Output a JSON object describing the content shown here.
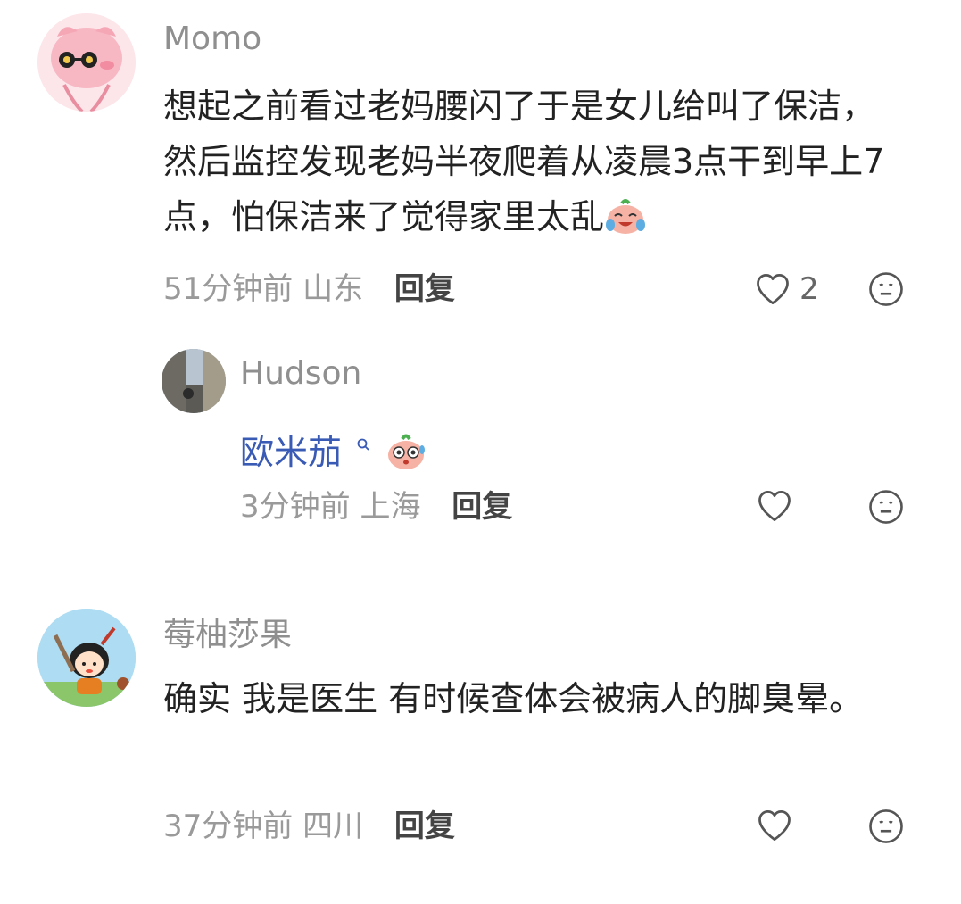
{
  "comments": [
    {
      "username": "Momo",
      "content": "想起之前看过老妈腰闪了于是女儿给叫了保洁，然后监控发现老妈半夜爬着从凌晨3点干到早上7点，怕保洁来了觉得家里太乱",
      "time": "51分钟前",
      "location": "山东",
      "reply_label": "回复",
      "like_count": "2",
      "emoji": "crying-laughing-peach-emoji"
    },
    {
      "username": "Hudson",
      "content": "欧米茄",
      "time": "3分钟前",
      "location": "上海",
      "reply_label": "回复",
      "like_count": "",
      "emoji": "surprised-peach-emoji"
    },
    {
      "username": "莓柚莎果",
      "content": "确实 我是医生 有时候查体会被病人的脚臭晕。",
      "time": "37分钟前",
      "location": "四川",
      "reply_label": "回复",
      "like_count": ""
    }
  ],
  "icons": {
    "like": "heart-outline-icon",
    "dislike": "neutral-face-icon",
    "search": "search-icon"
  },
  "colors": {
    "username": "#8f8f8f",
    "content": "#222222",
    "meta": "#9a9a9a",
    "link": "#3a5bb5"
  }
}
